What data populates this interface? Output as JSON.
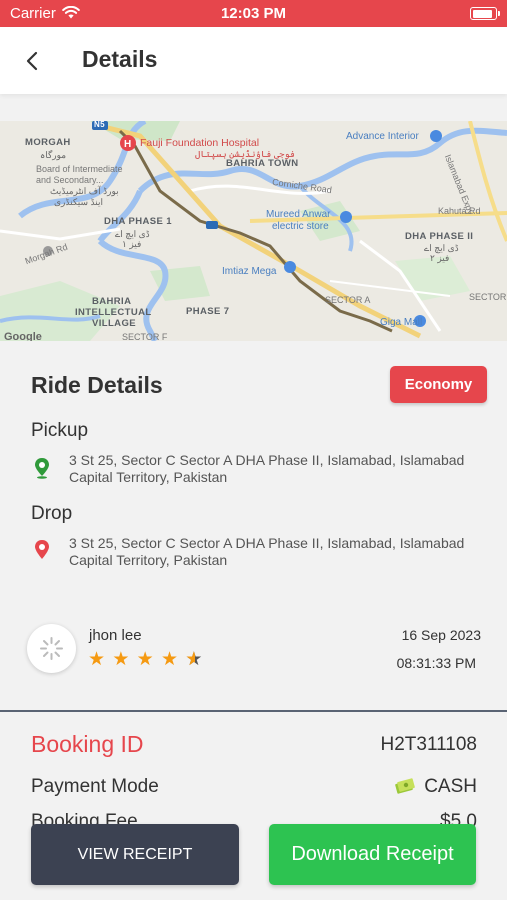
{
  "status_bar": {
    "carrier": "Carrier",
    "time": "12:03 PM"
  },
  "header": {
    "title": "Details"
  },
  "map": {
    "labels": {
      "morgah": "MORGAH",
      "morgah_urdu": "مورگاہ",
      "fauji": "Fauji Foundation Hospital",
      "fauji_urdu": "فوجی فاؤنڈیشن ہسپتال",
      "bahria_town": "BAHRIA TOWN",
      "advance": "Advance Interior",
      "board1": "Board of Intermediate",
      "board2": "and Secondary...",
      "board_urdu1": "بورڈ آف انٹرمیڈیٹ",
      "board_urdu2": "اینڈ سیکنڈری",
      "corniche": "Corniche Road",
      "kahuta": "Kahuta Rd",
      "dha1": "DHA PHASE 1",
      "dha1_urdu1": "ڈی ایچ اے",
      "dha1_urdu2": "فیز ١",
      "mureed1": "Mureed Anwar",
      "mureed2": "electric store",
      "dha2": "DHA PHASE II",
      "dha2_urdu1": "ڈی ایچ اے",
      "dha2_urdu2": "فیز ٢",
      "imtiaz": "Imtiaz Mega",
      "morgah_rd": "Morgah Rd",
      "bahria_iv1": "BAHRIA",
      "bahria_iv2": "INTELLECTUAL",
      "bahria_iv3": "VILLAGE",
      "phase7": "PHASE 7",
      "sector_a": "SECTOR A",
      "sector_g": "SECTOR G",
      "sector_f": "SECTOR F",
      "mall": "Giga Mall",
      "islamabad_exp": "Islamabad Expy",
      "n5": "N5",
      "google": "Google"
    }
  },
  "ride": {
    "title": "Ride Details",
    "category": "Economy",
    "pickup_label": "Pickup",
    "pickup_address": "3 St 25, Sector C Sector A DHA Phase II, Islamabad, Islamabad Capital Territory, Pakistan",
    "drop_label": "Drop",
    "drop_address": "3 St 25, Sector C Sector A DHA Phase II, Islamabad, Islamabad Capital Territory, Pakistan"
  },
  "driver": {
    "name": "jhon lee",
    "rating": 4.5,
    "rating_max": 5,
    "date": "16 Sep 2023",
    "time": "08:31:33 PM"
  },
  "booking": {
    "id_label": "Booking ID",
    "id_value": "H2T311108",
    "payment_label": "Payment Mode",
    "payment_value": "CASH",
    "fee_label": "Booking Fee",
    "fee_value": "$5.0"
  },
  "buttons": {
    "view_receipt": "VIEW RECEIPT",
    "download_receipt": "Download Receipt"
  },
  "colors": {
    "accent_red": "#e6464c",
    "download_green": "#2dc351",
    "view_dark": "#3c4252",
    "star": "#f59a12"
  }
}
